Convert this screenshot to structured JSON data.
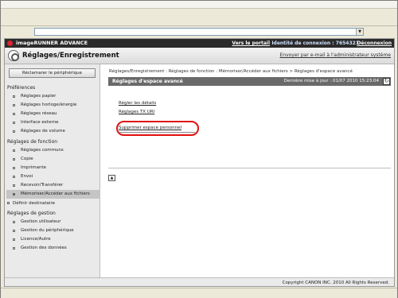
{
  "browser": {
    "address_value": "",
    "address_dropdown_icon": "chevron-down-icon"
  },
  "topbar": {
    "brand": "imageRUNNER ADVANCE",
    "portal_link": "Vers le portail",
    "login_id": "Identité de connexion : 7654321",
    "logout_link": "Déconnexion"
  },
  "header": {
    "title": "Réglages/Enregistrement",
    "email_link": "Envoyer par e-mail à l'administrateur système"
  },
  "sidebar": {
    "reset_button": "Réclamarer le périphérique",
    "sections": [
      {
        "heading": "Préférences",
        "items": [
          "Réglages papier",
          "Réglages horloge/énergie",
          "Réglages réseau",
          "Interface externe",
          "Réglages de volume"
        ]
      },
      {
        "heading": "Réglages de fonction",
        "items": [
          "Réglages communs",
          "Copie",
          "Imprimante",
          "Envoi",
          "Recevoir/Transférer",
          "Mémoriser/Accéder aux fichiers"
        ]
      }
    ],
    "define_recipient": "Définir destinataire",
    "management_heading": "Réglages de gestion",
    "management_items": [
      "Gestion utilisateur",
      "Gestion du périphérique",
      "Licence/Autre",
      "Gestion des données"
    ],
    "active_item": "Mémoriser/Accéder aux fichiers"
  },
  "main": {
    "breadcrumb": "Réglages/Enregistrement : Réglages de fonction : Mémoriser/Accéder aux fichiers > Réglages d'espace avancé",
    "section_title": "Réglages d'espace avancé",
    "last_update": "Dernière mise à jour : 01/07 2010 15:23:04",
    "links": [
      "Régler les détails",
      "Réglages TX URI",
      "Supprimer espace personnel"
    ],
    "top_button": "▲"
  },
  "footer": {
    "copyright": "Copyright CANON INC. 2010 All Rights Reserved."
  },
  "colors": {
    "brandbar": "#2b2b2b",
    "section_bar": "#6a6a6a",
    "highlight": "#e01010",
    "sidebar_bg": "#eaeaea"
  }
}
